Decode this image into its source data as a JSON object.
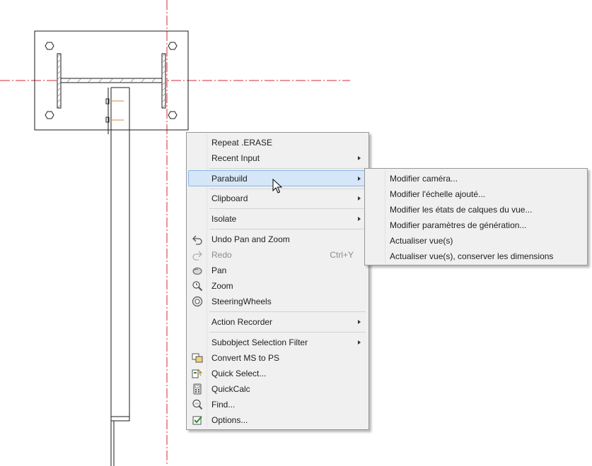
{
  "context_menu": {
    "items": [
      {
        "label": "Repeat .ERASE",
        "submenu": false
      },
      {
        "label": "Recent Input",
        "submenu": true
      },
      {
        "label": "Parabuild",
        "submenu": true,
        "highlighted": true
      },
      {
        "label": "Clipboard",
        "submenu": true
      },
      {
        "label": "Isolate",
        "submenu": true
      },
      {
        "label": "Undo Pan and Zoom",
        "icon": "undo-icon"
      },
      {
        "label": "Redo",
        "shortcut": "Ctrl+Y",
        "disabled": true,
        "icon": "redo-icon"
      },
      {
        "label": "Pan",
        "icon": "pan-hand-icon"
      },
      {
        "label": "Zoom",
        "icon": "zoom-icon"
      },
      {
        "label": "SteeringWheels",
        "icon": "steering-wheel-icon"
      },
      {
        "label": "Action Recorder",
        "submenu": true
      },
      {
        "label": "Subobject Selection Filter",
        "submenu": true
      },
      {
        "label": "Convert MS to PS",
        "icon": "convert-icon"
      },
      {
        "label": "Quick Select...",
        "icon": "quick-select-icon"
      },
      {
        "label": "QuickCalc",
        "icon": "calculator-icon"
      },
      {
        "label": "Find...",
        "icon": "find-icon"
      },
      {
        "label": "Options...",
        "icon": "options-check-icon"
      }
    ]
  },
  "parabuild_submenu": {
    "items": [
      {
        "label": "Modifier caméra..."
      },
      {
        "label": "Modifier l'échelle ajouté..."
      },
      {
        "label": "Modifier les états de calques du vue..."
      },
      {
        "label": "Modifier paramètres de génération..."
      },
      {
        "label": "Actualiser vue(s)"
      },
      {
        "label": "Actualiser vue(s), conserver les dimensions"
      }
    ]
  },
  "colors": {
    "centerline": "#d6283a",
    "highlight_bg": "#d5e6f8",
    "highlight_border": "#8bb7e6",
    "menu_bg": "#f0f0f0"
  }
}
